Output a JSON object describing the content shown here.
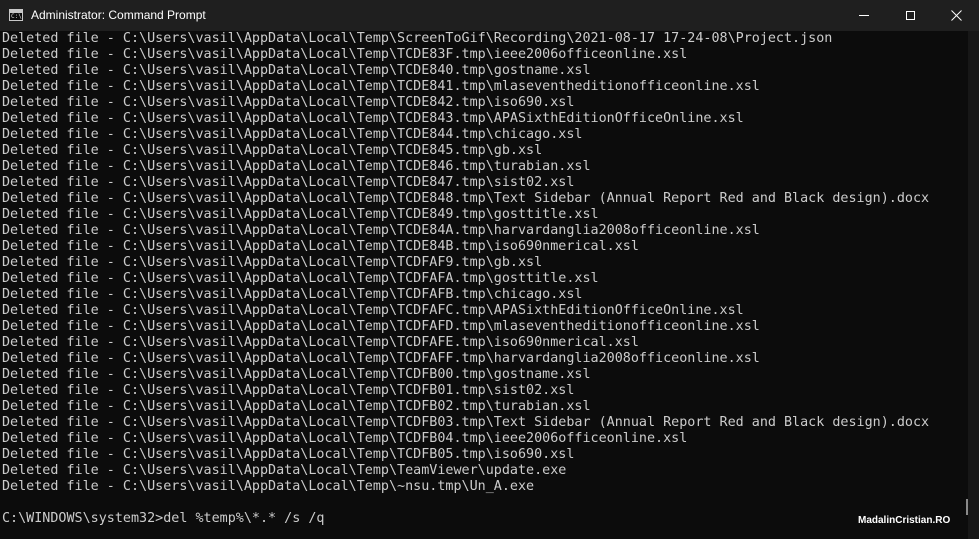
{
  "window": {
    "title": "Administrator: Command Prompt",
    "app_icon_text": "C:\\"
  },
  "controls": {
    "minimize": "minimize-icon",
    "maximize": "maximize-icon",
    "close": "close-icon"
  },
  "console": {
    "lines": [
      "Deleted file - C:\\Users\\vasil\\AppData\\Local\\Temp\\ScreenToGif\\Recording\\2021-08-17 17-24-08\\Project.json",
      "Deleted file - C:\\Users\\vasil\\AppData\\Local\\Temp\\TCDE83F.tmp\\ieee2006officeonline.xsl",
      "Deleted file - C:\\Users\\vasil\\AppData\\Local\\Temp\\TCDE840.tmp\\gostname.xsl",
      "Deleted file - C:\\Users\\vasil\\AppData\\Local\\Temp\\TCDE841.tmp\\mlaseventheditionofficeonline.xsl",
      "Deleted file - C:\\Users\\vasil\\AppData\\Local\\Temp\\TCDE842.tmp\\iso690.xsl",
      "Deleted file - C:\\Users\\vasil\\AppData\\Local\\Temp\\TCDE843.tmp\\APASixthEditionOfficeOnline.xsl",
      "Deleted file - C:\\Users\\vasil\\AppData\\Local\\Temp\\TCDE844.tmp\\chicago.xsl",
      "Deleted file - C:\\Users\\vasil\\AppData\\Local\\Temp\\TCDE845.tmp\\gb.xsl",
      "Deleted file - C:\\Users\\vasil\\AppData\\Local\\Temp\\TCDE846.tmp\\turabian.xsl",
      "Deleted file - C:\\Users\\vasil\\AppData\\Local\\Temp\\TCDE847.tmp\\sist02.xsl",
      "Deleted file - C:\\Users\\vasil\\AppData\\Local\\Temp\\TCDE848.tmp\\Text Sidebar (Annual Report Red and Black design).docx",
      "Deleted file - C:\\Users\\vasil\\AppData\\Local\\Temp\\TCDE849.tmp\\gosttitle.xsl",
      "Deleted file - C:\\Users\\vasil\\AppData\\Local\\Temp\\TCDE84A.tmp\\harvardanglia2008officeonline.xsl",
      "Deleted file - C:\\Users\\vasil\\AppData\\Local\\Temp\\TCDE84B.tmp\\iso690nmerical.xsl",
      "Deleted file - C:\\Users\\vasil\\AppData\\Local\\Temp\\TCDFAF9.tmp\\gb.xsl",
      "Deleted file - C:\\Users\\vasil\\AppData\\Local\\Temp\\TCDFAFA.tmp\\gosttitle.xsl",
      "Deleted file - C:\\Users\\vasil\\AppData\\Local\\Temp\\TCDFAFB.tmp\\chicago.xsl",
      "Deleted file - C:\\Users\\vasil\\AppData\\Local\\Temp\\TCDFAFC.tmp\\APASixthEditionOfficeOnline.xsl",
      "Deleted file - C:\\Users\\vasil\\AppData\\Local\\Temp\\TCDFAFD.tmp\\mlaseventheditionofficeonline.xsl",
      "Deleted file - C:\\Users\\vasil\\AppData\\Local\\Temp\\TCDFAFE.tmp\\iso690nmerical.xsl",
      "Deleted file - C:\\Users\\vasil\\AppData\\Local\\Temp\\TCDFAFF.tmp\\harvardanglia2008officeonline.xsl",
      "Deleted file - C:\\Users\\vasil\\AppData\\Local\\Temp\\TCDFB00.tmp\\gostname.xsl",
      "Deleted file - C:\\Users\\vasil\\AppData\\Local\\Temp\\TCDFB01.tmp\\sist02.xsl",
      "Deleted file - C:\\Users\\vasil\\AppData\\Local\\Temp\\TCDFB02.tmp\\turabian.xsl",
      "Deleted file - C:\\Users\\vasil\\AppData\\Local\\Temp\\TCDFB03.tmp\\Text Sidebar (Annual Report Red and Black design).docx",
      "Deleted file - C:\\Users\\vasil\\AppData\\Local\\Temp\\TCDFB04.tmp\\ieee2006officeonline.xsl",
      "Deleted file - C:\\Users\\vasil\\AppData\\Local\\Temp\\TCDFB05.tmp\\iso690.xsl",
      "Deleted file - C:\\Users\\vasil\\AppData\\Local\\Temp\\TeamViewer\\update.exe",
      "Deleted file - C:\\Users\\vasil\\AppData\\Local\\Temp\\~nsu.tmp\\Un_A.exe",
      "",
      "C:\\WINDOWS\\system32>del %temp%\\*.* /s /q"
    ]
  },
  "watermark": "MadalinCristian.RO",
  "colors": {
    "background": "#0c0c0c",
    "titlebar": "#1f1f1f",
    "text": "#cccccc"
  }
}
